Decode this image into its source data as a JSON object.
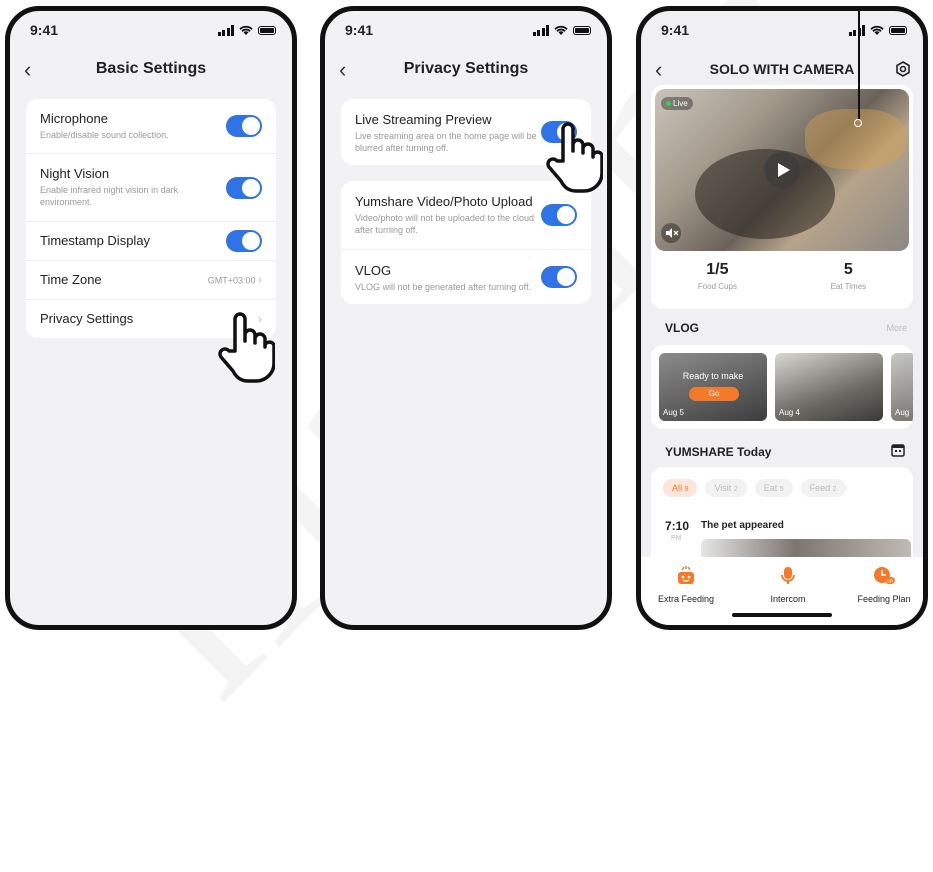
{
  "status_time": "9:41",
  "screen1": {
    "title": "Basic Settings",
    "rows": [
      {
        "title": "Microphone",
        "desc": "Enable/disable sound collection."
      },
      {
        "title": "Night Vision",
        "desc": "Enable infrared night vision in dark environment."
      },
      {
        "title": "Timestamp Display"
      },
      {
        "title": "Time Zone",
        "value": "GMT+03:00"
      },
      {
        "title": "Privacy Settings"
      }
    ]
  },
  "screen2": {
    "title": "Privacy Settings",
    "rows": [
      {
        "title": "Live Streaming Preview",
        "desc": "Live streaming area on the home page will be blurred after turning off."
      },
      {
        "title": "Yumshare Video/Photo Upload",
        "desc": "Video/photo will not be uploaded to the cloud after turning off."
      },
      {
        "title": "VLOG",
        "desc": "VLOG will not be generated after turning off."
      }
    ]
  },
  "screen3": {
    "title": "SOLO WITH CAMERA",
    "live_badge": "Live",
    "stats": [
      {
        "value": "1/5",
        "label": "Food Cups"
      },
      {
        "value": "5",
        "label": "Eat Times"
      }
    ],
    "vlog": {
      "title": "VLOG",
      "more": "More",
      "cards": [
        {
          "date": "Aug 5",
          "overlay": "Ready to make",
          "button": "Go"
        },
        {
          "date": "Aug 4"
        },
        {
          "date": "Aug"
        }
      ]
    },
    "today": {
      "title": "YUMSHARE Today",
      "filters": [
        {
          "label": "All",
          "count": "9"
        },
        {
          "label": "Visit",
          "count": "2"
        },
        {
          "label": "Eat",
          "count": "5"
        },
        {
          "label": "Feed",
          "count": "2"
        }
      ],
      "event": {
        "time": "7:10",
        "ampm": "PM",
        "text": "The pet appeared"
      }
    },
    "bottom_nav": [
      {
        "label": "Extra Feeding",
        "icon": "extra-feeding-icon"
      },
      {
        "label": "Intercom",
        "icon": "intercom-icon"
      },
      {
        "label": "Feeding Plan",
        "icon": "feeding-plan-icon",
        "badge": "on"
      }
    ]
  },
  "colors": {
    "accent": "#2f73e6",
    "orange": "#f47a2a"
  }
}
